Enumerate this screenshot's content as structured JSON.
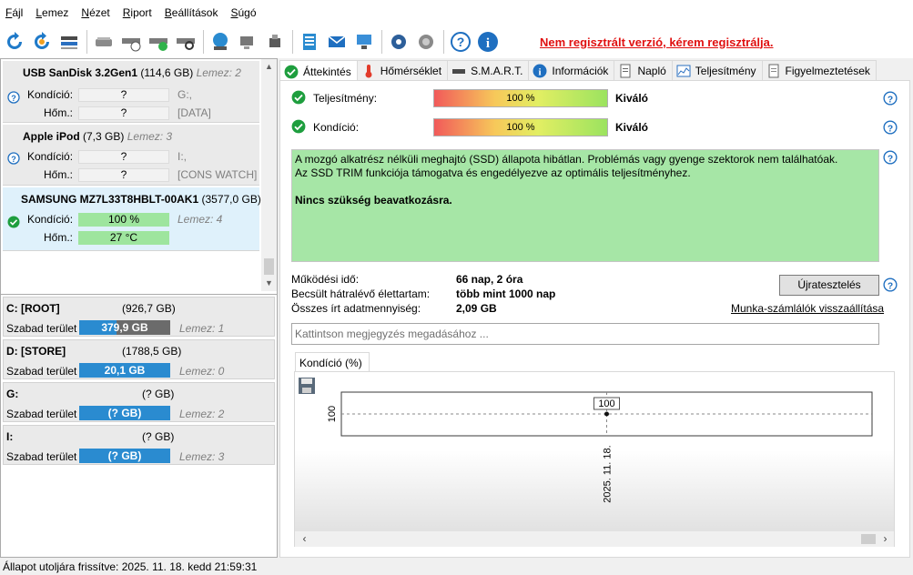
{
  "menu": {
    "items": [
      {
        "u": "F",
        "rest": "ájl"
      },
      {
        "u": "L",
        "rest": "emez"
      },
      {
        "u": "N",
        "rest": "ézet"
      },
      {
        "u": "R",
        "rest": "iport"
      },
      {
        "u": "B",
        "rest": "eállítások"
      },
      {
        "u": "S",
        "rest": "úgó"
      }
    ]
  },
  "toolbar": {
    "unregistered": "Nem regisztrált verzió, kérem regisztrálja."
  },
  "disks": [
    {
      "name": "USB SanDisk 3.2Gen1",
      "size": "(114,6 GB)",
      "lemez": "Lemez: 2",
      "condition_label": "Kondíció:",
      "condition_value": "?",
      "condition_extra": "G:,",
      "temp_label": "Hőm.:",
      "temp_value": "?",
      "temp_extra": "[DATA]"
    },
    {
      "name": "Apple  iPod",
      "size": "(7,3 GB)",
      "lemez": "Lemez: 3",
      "condition_label": "Kondíció:",
      "condition_value": "?",
      "condition_extra": "I:,",
      "temp_label": "Hőm.:",
      "temp_value": "?",
      "temp_extra": "[CONS WATCH]"
    },
    {
      "name": "SAMSUNG MZ7L33T8HBLT-00AK1",
      "size": "(3577,0 GB)",
      "lemez": "Lemez: 4",
      "condition_label": "Kondíció:",
      "condition_value": "100 %",
      "condition_extra": "",
      "temp_label": "Hőm.:",
      "temp_value": "27 °C",
      "temp_extra": ""
    }
  ],
  "volumes": [
    {
      "name": "C: [ROOT]",
      "size": "(926,7 GB)",
      "free_label": "Szabad terület",
      "free": "379,9 GB",
      "lemez": "Lemez: 1",
      "free_fraction": 0.41
    },
    {
      "name": "D: [STORE]",
      "size": "(1788,5 GB)",
      "free_label": "Szabad terület",
      "free": "20,1 GB",
      "lemez": "Lemez: 0",
      "free_fraction": 1.0
    },
    {
      "name": "G:",
      "size": "(? GB)",
      "free_label": "Szabad terület",
      "free": "(? GB)",
      "lemez": "Lemez: 2",
      "free_fraction": 1.0
    },
    {
      "name": "I:",
      "size": "(? GB)",
      "free_label": "Szabad terület",
      "free": "(? GB)",
      "lemez": "Lemez: 3",
      "free_fraction": 1.0
    }
  ],
  "tabs": [
    "Áttekintés",
    "Hőmérséklet",
    "S.M.A.R.T.",
    "Információk",
    "Napló",
    "Teljesítmény",
    "Figyelmeztetések"
  ],
  "overview": {
    "performance_label": "Teljesítmény:",
    "performance_value": "100 %",
    "performance_word": "Kiváló",
    "condition_label": "Kondíció:",
    "condition_value": "100 %",
    "condition_word": "Kiváló",
    "status_line1": "A mozgó alkatrész nélküli meghajtó (SSD) állapota hibátlan. Problémás vagy gyenge szektorok nem találhatóak.",
    "status_line2": "Az SSD TRIM funkciója támogatva és engedélyezve az optimális teljesítményhez.",
    "status_line3": "Nincs szükség beavatkozásra.",
    "uptime_label": "Működési idő:",
    "uptime_value": "66 nap, 2 óra",
    "life_label": "Becsült hátralévő élettartam:",
    "life_value": "több mint 1000 nap",
    "written_label": "Összes írt adatmennyiség:",
    "written_value": "2,09 GB",
    "retest_button": "Újratesztelés",
    "reset_link": "Munka-számlálók visszaállítása",
    "note_placeholder": "Kattintson megjegyzés megadásához ..."
  },
  "chart_tab": "Kondíció  (%)",
  "chart_data": {
    "type": "line",
    "x": [
      "2025. 11. 18."
    ],
    "y": [
      100
    ],
    "ytick": "100",
    "point_label": "100"
  },
  "statusbar": "Állapot utoljára frissítve: 2025. 11. 18. kedd 21:59:31",
  "colors": {
    "accent_blue": "#2a8bd0",
    "ok_green": "#1e9e3e",
    "status_bg": "#a6e6a6",
    "warning_red": "#e01010"
  }
}
